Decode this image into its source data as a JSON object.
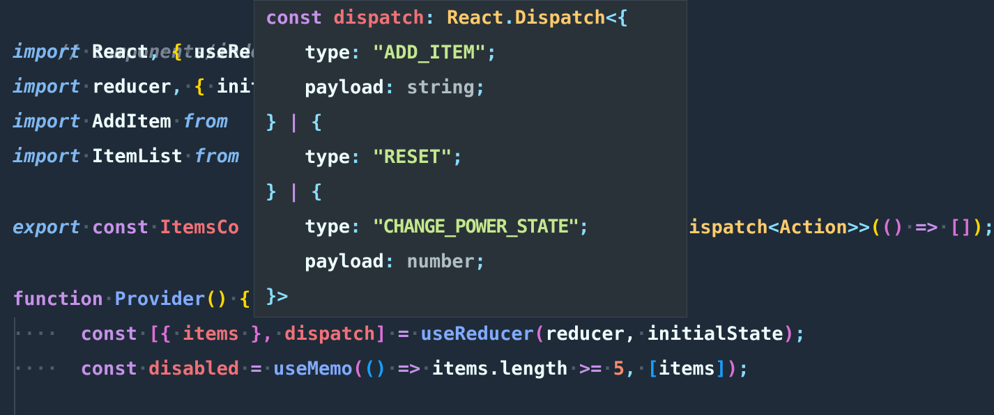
{
  "colors": {
    "comment": "#7b8694",
    "keyword": "#7fb7f0",
    "storage": "#c792ea",
    "variable": "#f07178",
    "func": "#82aaff",
    "type": "#ffcb6b",
    "string": "#c3e88d",
    "punct": "#89ddff",
    "text": "#eeffff",
    "number": "#f78c6c",
    "muted": "#b0bec5",
    "brace": "#ffd700",
    "brace2": "#da70d6",
    "brace3": "#179fff"
  },
  "editor": {
    "line1": {
      "comment": "// components/indes."
    },
    "line2": {
      "kw": "import",
      "name": "React",
      "comma": ",",
      "brace": "{",
      "rest": "useRe"
    },
    "line3": {
      "kw": "import",
      "name": "reducer",
      "comma": ",",
      "brace": "{",
      "rest": "init"
    },
    "line4": {
      "kw": "import",
      "name": "AddItem",
      "from": "from"
    },
    "line5": {
      "kw": "import",
      "name": "ItemList",
      "from": "from"
    },
    "line7": {
      "kw": "export",
      "const": "const",
      "name": "ItemsCo",
      "tail_fn": "ispatch",
      "tail_lt": "<",
      "tail_type": "Action",
      "tail_gt": ">>",
      "tail_p1": "(",
      "tail_p2": "()",
      "tail_arrow": "=>",
      "tail_arr": "[]",
      "tail_p3": ")",
      "tail_semi": ";"
    },
    "line9": {
      "kw": "function",
      "name": "Provider",
      "parens": "()",
      "brace": "{"
    },
    "line10": {
      "const": "const",
      "open": "[{",
      "items": "items",
      "close1": "},",
      "dispatch": "dispatch",
      "close2": "]",
      "eq": "=",
      "fn": "useReducer",
      "p1": "(",
      "arg1": "reducer,",
      "arg2": "initialState",
      "p2": ")",
      "semi": ";"
    },
    "line11": {
      "const": "const",
      "name": "disabled",
      "eq": "=",
      "fn": "useMemo",
      "p1": "(",
      "p2": "()",
      "arrow": "=>",
      "expr": "items.length",
      "op": ">=",
      "num": "5",
      "comma": ",",
      "arr_open": "[",
      "arr_item": "items",
      "arr_close": "]",
      "p3": ")",
      "semi": ";"
    }
  },
  "tooltip": {
    "line1": {
      "const": "const",
      "name": "dispatch",
      "colon": ":",
      "ns": "React",
      "dot": ".",
      "type": "Dispatch",
      "open": "<{"
    },
    "line2": {
      "key": "type",
      "colon": ":",
      "value": "\"ADD_ITEM\"",
      "semi": ";"
    },
    "line3": {
      "key": "payload",
      "colon": ":",
      "value": "string",
      "semi": ";"
    },
    "line4": {
      "close": "}",
      "pipe": "|",
      "open": "{"
    },
    "line5": {
      "key": "type",
      "colon": ":",
      "value": "\"RESET\"",
      "semi": ";"
    },
    "line6": {
      "close": "}",
      "pipe": "|",
      "open": "{"
    },
    "line7": {
      "key": "type",
      "colon": ":",
      "value": "\"CHANGE_POWER_STATE\"",
      "semi": ";"
    },
    "line8": {
      "key": "payload",
      "colon": ":",
      "value": "number",
      "semi": ";"
    },
    "line9": {
      "close": "}>"
    }
  }
}
